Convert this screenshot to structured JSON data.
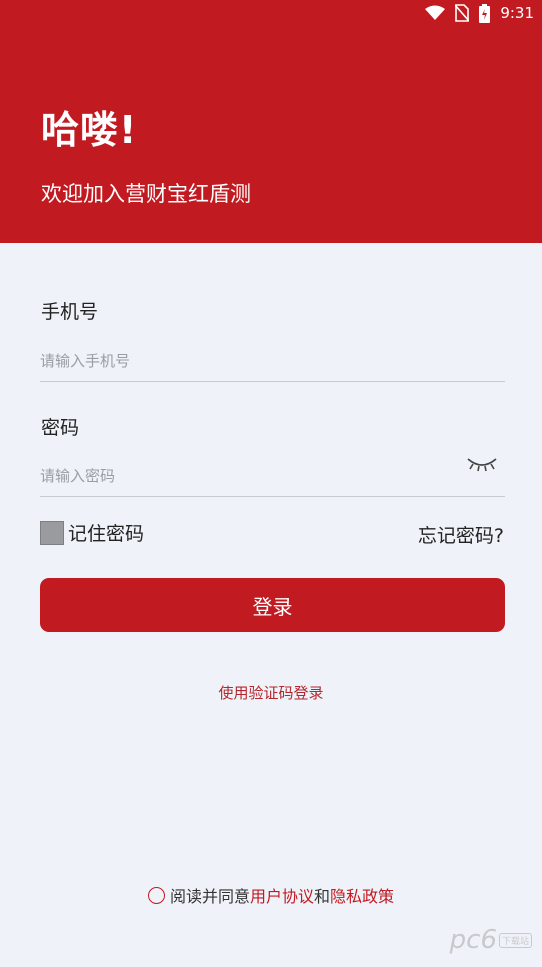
{
  "status_bar": {
    "time": "9:31"
  },
  "header": {
    "greeting": "哈喽!",
    "welcome": "欢迎加入营财宝红盾测"
  },
  "form": {
    "phone_label": "手机号",
    "phone_placeholder": "请输入手机号",
    "password_label": "密码",
    "password_placeholder": "请输入密码",
    "remember_label": "记住密码",
    "forgot_label": "忘记密码?",
    "login_button": "登录",
    "sms_login": "使用验证码登录"
  },
  "agreement": {
    "prefix": "阅读并同意",
    "user_agreement": "用户协议",
    "conjunction": "和",
    "privacy_policy": "隐私政策"
  },
  "watermark": {
    "text": "pc6",
    "sub": "下载站"
  },
  "colors": {
    "brand": "#c21a21",
    "background": "#eff2f9"
  }
}
